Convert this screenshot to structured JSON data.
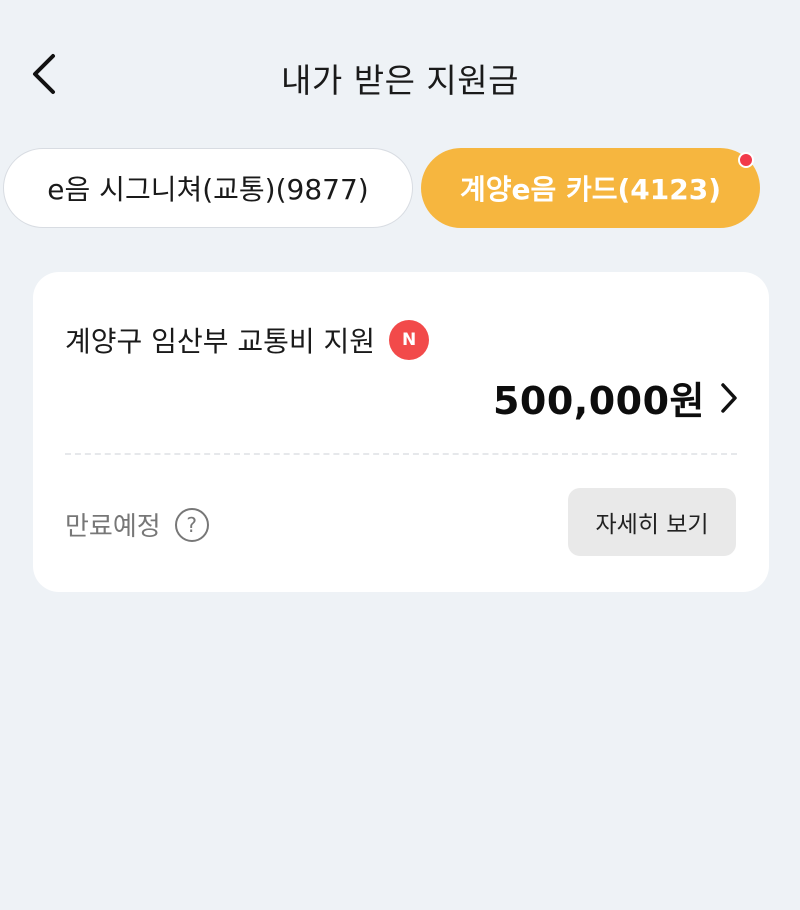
{
  "header": {
    "title": "내가 받은 지원금",
    "back_icon": "chevron-left-icon"
  },
  "tabs": [
    {
      "label": "e음 시그니쳐(교통)(9877)",
      "active": false
    },
    {
      "label": "계양e음 카드(4123)",
      "active": true,
      "has_notification_dot": true
    }
  ],
  "colors": {
    "background": "#eef2f6",
    "active_tab": "#f6b63f",
    "badge_red": "#f24a4a",
    "dot_red": "#f23a4a"
  },
  "support_card": {
    "title": "계양구 임산부 교통비 지원",
    "new_badge": "N",
    "amount": "500,000원",
    "expire_label": "만료예정",
    "help_symbol": "?",
    "detail_button": "자세히 보기"
  }
}
